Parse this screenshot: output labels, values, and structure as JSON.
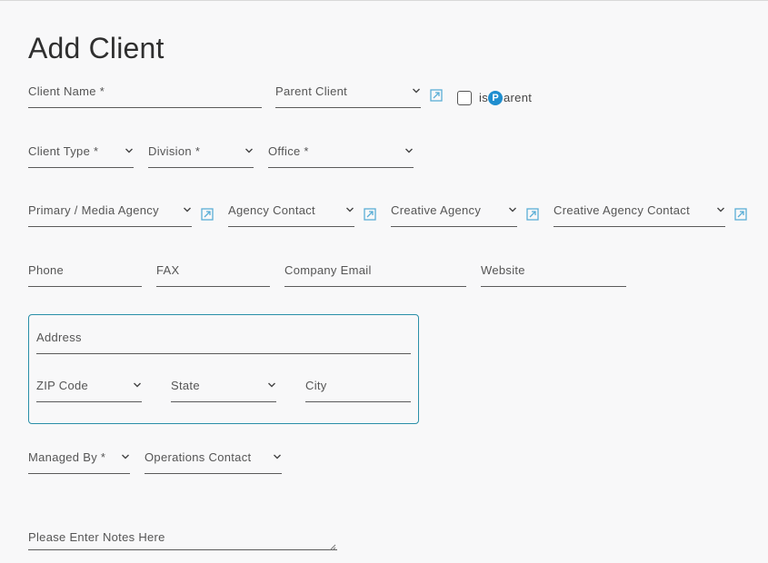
{
  "page": {
    "title": "Add Client"
  },
  "fields": {
    "client_name": "Client Name *",
    "parent_client": "Parent Client",
    "is_parent_prefix": "is",
    "is_parent_badge": "P",
    "is_parent_suffix": "arent",
    "client_type": "Client Type *",
    "division": "Division *",
    "office": "Office *",
    "primary_media_agency": "Primary / Media Agency",
    "agency_contact": "Agency Contact",
    "creative_agency": "Creative Agency",
    "creative_agency_contact": "Creative Agency Contact",
    "phone": "Phone",
    "fax": "FAX",
    "company_email": "Company Email",
    "website": "Website",
    "address": "Address",
    "zip_code": "ZIP Code",
    "state": "State",
    "city": "City",
    "managed_by": "Managed By *",
    "operations_contact": "Operations Contact",
    "notes": "Please Enter Notes Here"
  },
  "icons": {
    "dropdown": "chevron-down-icon",
    "open_external": "open-external-icon"
  },
  "colors": {
    "accent": "#1f8ecf",
    "address_border": "#2a8fa8",
    "external_icon": "#5aaed6"
  }
}
